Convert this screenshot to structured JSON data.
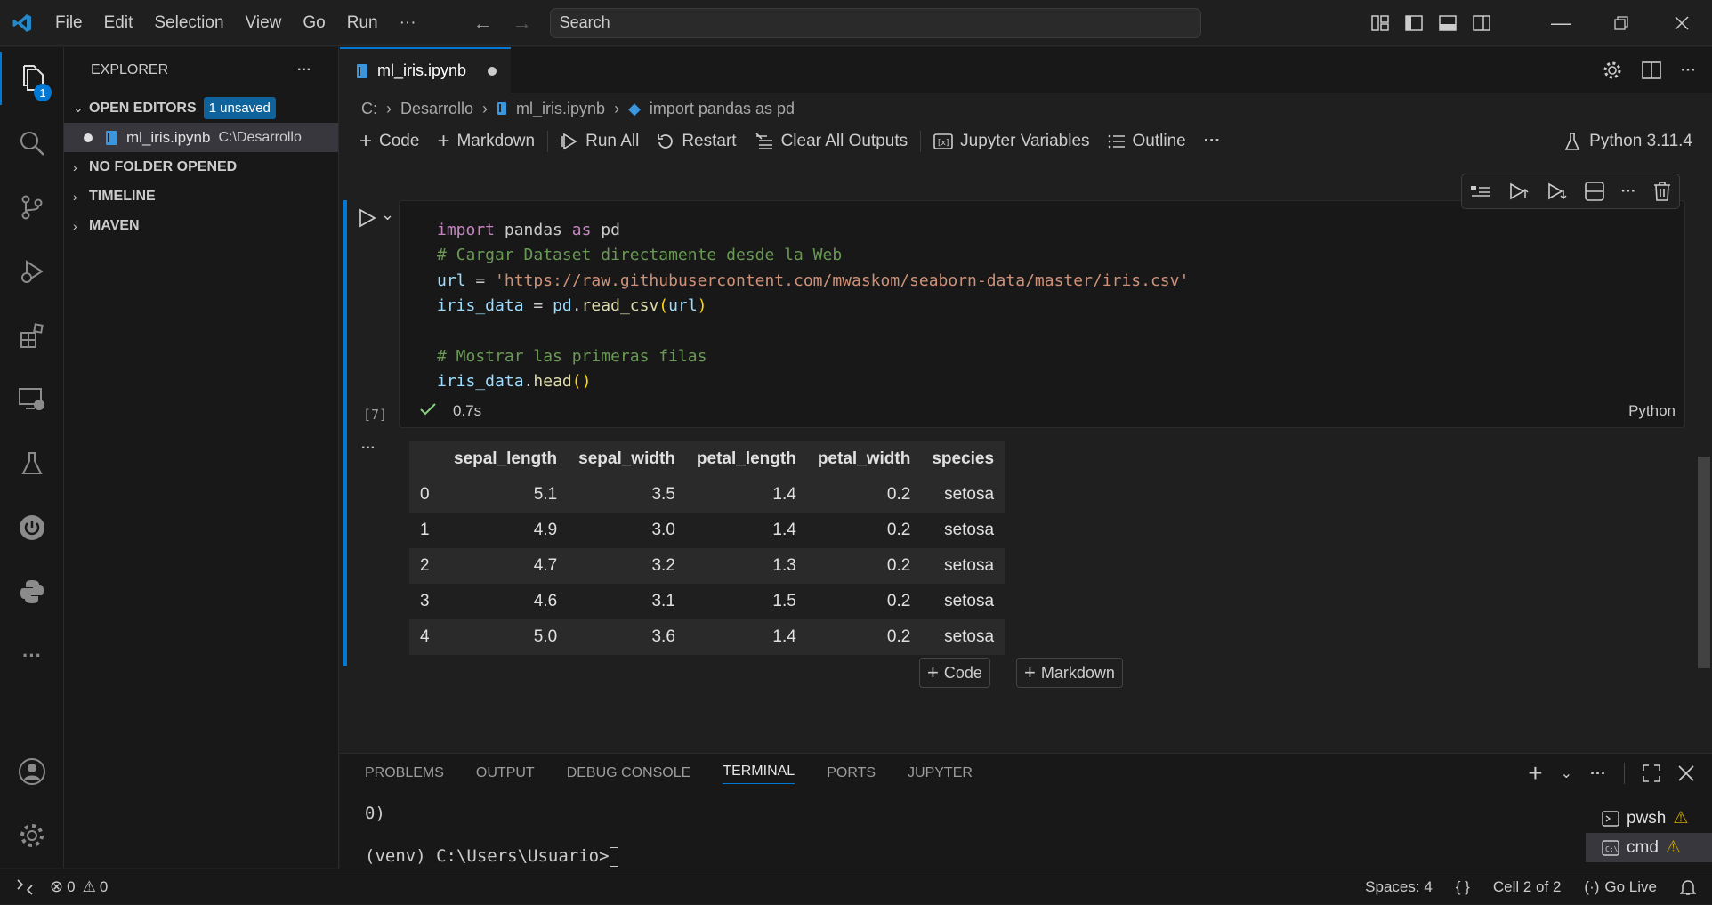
{
  "titlebar": {
    "menu": [
      "File",
      "Edit",
      "Selection",
      "View",
      "Go",
      "Run",
      "···"
    ],
    "search_placeholder": "Search"
  },
  "activity_badge": "1",
  "sidebar": {
    "title": "EXPLORER",
    "more": "···",
    "open_editors": "OPEN EDITORS",
    "unsaved_badge": "1 unsaved",
    "open_file_name": "ml_iris.ipynb",
    "open_file_path": "C:\\Desarrollo",
    "sections": [
      "NO FOLDER OPENED",
      "TIMELINE",
      "MAVEN"
    ]
  },
  "editor": {
    "tab_label": "ml_iris.ipynb",
    "breadcrumb": [
      "C:",
      "Desarrollo",
      "ml_iris.ipynb",
      "import pandas as pd"
    ],
    "toolbar": {
      "code": "Code",
      "markdown": "Markdown",
      "run_all": "Run All",
      "restart": "Restart",
      "clear_outputs": "Clear All Outputs",
      "jupyter_variables": "Jupyter Variables",
      "outline": "Outline",
      "more": "···",
      "kernel": "Python 3.11.4"
    },
    "cell": {
      "exec_count": "[7]",
      "duration": "0.7s",
      "language": "Python",
      "output_more": "···",
      "code": {
        "l1_kw": "import",
        "l1_a": " pandas ",
        "l1_as": "as",
        "l1_b": " pd",
        "l2": "# Cargar Dataset directamente desde la Web",
        "l3_a": "url",
        "l3_b": " = ",
        "l3_q1": "'",
        "l3_url": "https://raw.githubusercontent.com/mwaskom/seaborn-data/master/iris.csv",
        "l3_q2": "'",
        "l4_a": "iris_data",
        "l4_b": " = ",
        "l4_c": "pd",
        "l4_d": ".",
        "l4_fn": "read_csv",
        "l4_p1": "(",
        "l4_arg": "url",
        "l4_p2": ")",
        "l6": "# Mostrar las primeras filas",
        "l7_a": "iris_data",
        "l7_b": ".",
        "l7_fn": "head",
        "l7_p": "()"
      }
    },
    "table": {
      "columns": [
        "",
        "sepal_length",
        "sepal_width",
        "petal_length",
        "petal_width",
        "species"
      ],
      "rows": [
        [
          "0",
          "5.1",
          "3.5",
          "1.4",
          "0.2",
          "setosa"
        ],
        [
          "1",
          "4.9",
          "3.0",
          "1.4",
          "0.2",
          "setosa"
        ],
        [
          "2",
          "4.7",
          "3.2",
          "1.3",
          "0.2",
          "setosa"
        ],
        [
          "3",
          "4.6",
          "3.1",
          "1.5",
          "0.2",
          "setosa"
        ],
        [
          "4",
          "5.0",
          "3.6",
          "1.4",
          "0.2",
          "setosa"
        ]
      ]
    },
    "add_code": "Code",
    "add_markdown": "Markdown"
  },
  "panel": {
    "tabs": [
      "PROBLEMS",
      "OUTPUT",
      "DEBUG CONSOLE",
      "TERMINAL",
      "PORTS",
      "JUPYTER"
    ],
    "active_tab": "TERMINAL",
    "more": "···",
    "terminal_line1": "0)",
    "terminal_prompt": "(venv) C:\\Users\\Usuario>",
    "terminals": [
      "pwsh",
      "cmd"
    ]
  },
  "statusbar": {
    "errors": "0",
    "warnings": "0",
    "spaces": "Spaces: 4",
    "braces": "{ }",
    "cell": "Cell 2 of 2",
    "go_live": "Go Live"
  }
}
